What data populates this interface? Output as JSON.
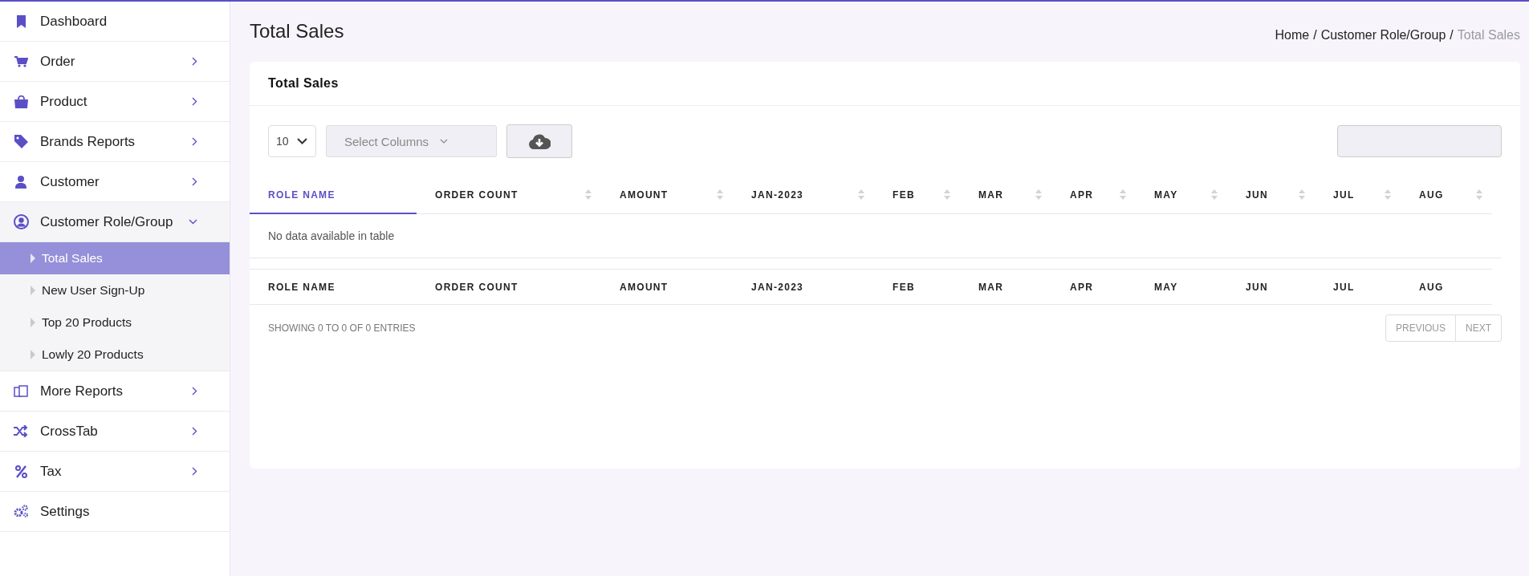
{
  "sidebar": {
    "items": [
      {
        "label": "Dashboard",
        "kind": "link"
      },
      {
        "label": "Order",
        "kind": "group",
        "expanded": false
      },
      {
        "label": "Product",
        "kind": "group",
        "expanded": false
      },
      {
        "label": "Brands Reports",
        "kind": "group",
        "expanded": false
      },
      {
        "label": "Customer",
        "kind": "group",
        "expanded": false
      },
      {
        "label": "Customer Role/Group",
        "kind": "group",
        "expanded": true,
        "children": [
          {
            "label": "Total Sales",
            "selected": true
          },
          {
            "label": "New User Sign-Up",
            "selected": false
          },
          {
            "label": "Top 20 Products",
            "selected": false
          },
          {
            "label": "Lowly 20 Products",
            "selected": false
          }
        ]
      },
      {
        "label": "More Reports",
        "kind": "group",
        "expanded": false
      },
      {
        "label": "CrossTab",
        "kind": "group",
        "expanded": false
      },
      {
        "label": "Tax",
        "kind": "group",
        "expanded": false
      },
      {
        "label": "Settings",
        "kind": "link"
      }
    ]
  },
  "page": {
    "title": "Total Sales",
    "breadcrumb": [
      {
        "label": "Home",
        "current": false
      },
      {
        "label": "Customer Role/Group",
        "current": false
      },
      {
        "label": "Total Sales",
        "current": true
      }
    ],
    "separator": "/"
  },
  "card": {
    "title": "Total Sales",
    "toolbar": {
      "page_size": "10",
      "columns_placeholder": "Select Columns"
    },
    "table": {
      "columns": [
        {
          "label": "ROLE NAME",
          "selected": true
        },
        {
          "label": "ORDER COUNT",
          "selected": false
        },
        {
          "label": "AMOUNT",
          "selected": false
        },
        {
          "label": "JAN-2023",
          "selected": false
        },
        {
          "label": "FEB",
          "selected": false
        },
        {
          "label": "MAR",
          "selected": false
        },
        {
          "label": "APR",
          "selected": false
        },
        {
          "label": "MAY",
          "selected": false
        },
        {
          "label": "JUN",
          "selected": false
        },
        {
          "label": "JUL",
          "selected": false
        },
        {
          "label": "AUG",
          "selected": false
        }
      ],
      "empty_message": "No data available in table",
      "footer_columns": [
        "ROLE NAME",
        "ORDER COUNT",
        "AMOUNT",
        "JAN-2023",
        "FEB",
        "MAR",
        "APR",
        "MAY",
        "JUN",
        "JUL",
        "AUG"
      ]
    },
    "info": "SHOWING 0 TO 0 OF 0 ENTRIES",
    "pagination": [
      {
        "label": "PREVIOUS",
        "disabled": true
      },
      {
        "label": "NEXT",
        "disabled": true
      }
    ]
  }
}
